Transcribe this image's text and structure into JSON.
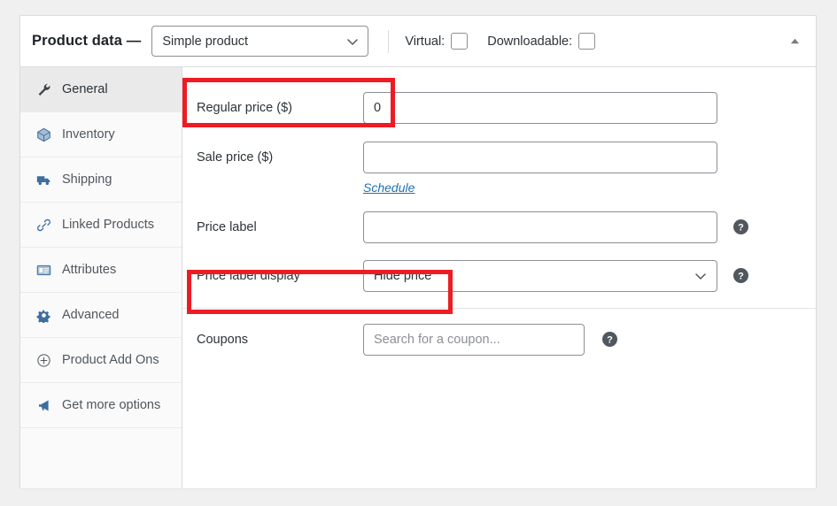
{
  "header": {
    "title": "Product data —",
    "product_type": {
      "value": "Simple product",
      "icon": "chevron-down-icon"
    },
    "virtual": {
      "label": "Virtual:",
      "checked": false
    },
    "downloadable": {
      "label": "Downloadable:",
      "checked": false
    },
    "collapse_icon": "caret-up-icon"
  },
  "tabs": [
    {
      "label": "General",
      "icon": "wrench-icon",
      "active": true
    },
    {
      "label": "Inventory",
      "icon": "box-icon",
      "active": false
    },
    {
      "label": "Shipping",
      "icon": "truck-icon",
      "active": false
    },
    {
      "label": "Linked Products",
      "icon": "link-icon",
      "active": false
    },
    {
      "label": "Attributes",
      "icon": "list-card-icon",
      "active": false
    },
    {
      "label": "Advanced",
      "icon": "gear-icon",
      "active": false
    },
    {
      "label": "Product Add Ons",
      "icon": "plus-circle-icon",
      "active": false
    },
    {
      "label": "Get more options",
      "icon": "megaphone-icon",
      "active": false
    }
  ],
  "fields": {
    "regular_price": {
      "label": "Regular price ($)",
      "value": "0",
      "placeholder": ""
    },
    "sale_price": {
      "label": "Sale price ($)",
      "value": "",
      "placeholder": "",
      "schedule_link": "Schedule"
    },
    "price_label": {
      "label": "Price label",
      "value": "",
      "placeholder": "",
      "help_icon": "help-circle-icon"
    },
    "price_label_display": {
      "label": "Price label display",
      "value": "Hide price",
      "help_icon": "help-circle-icon",
      "icon": "chevron-down-icon"
    },
    "coupons": {
      "label": "Coupons",
      "value": "",
      "placeholder": "Search for a coupon...",
      "help_icon": "help-circle-icon"
    }
  },
  "annotations": {
    "highlight_color": "#ed1c24",
    "boxes": [
      {
        "target": "regular-price-row"
      },
      {
        "target": "price-label-display-row"
      }
    ]
  },
  "colors": {
    "page_background": "#f0f0f1",
    "panel_background": "#ffffff",
    "border": "#dcdcde",
    "link": "#2271b1",
    "text": "#2c3338",
    "muted_text": "#50575e",
    "icon_blue": "#3c6e9f",
    "active_tab_background": "#eaeaea"
  }
}
